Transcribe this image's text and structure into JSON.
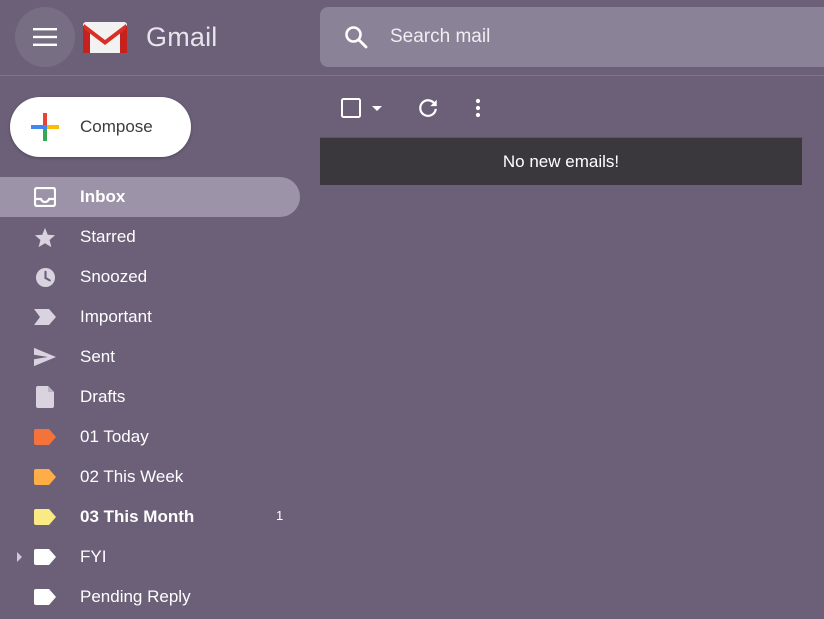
{
  "app": {
    "logo_text": "Gmail",
    "brand_colors": {
      "red": "#d93025",
      "logo_red": "#c5221f"
    }
  },
  "header": {
    "search_placeholder": "Search mail"
  },
  "compose": {
    "label": "Compose"
  },
  "nav": {
    "items": [
      {
        "label": "Inbox",
        "icon": "inbox-icon",
        "active": true,
        "bold": true
      },
      {
        "label": "Starred",
        "icon": "star-icon"
      },
      {
        "label": "Snoozed",
        "icon": "clock-icon"
      },
      {
        "label": "Important",
        "icon": "important-icon"
      },
      {
        "label": "Sent",
        "icon": "send-icon"
      },
      {
        "label": "Drafts",
        "icon": "draft-icon"
      },
      {
        "label": "01 Today",
        "icon": "label-icon",
        "color": "#f4733b"
      },
      {
        "label": "02 This Week",
        "icon": "label-icon",
        "color": "#ffad46"
      },
      {
        "label": "03 This Month",
        "icon": "label-icon",
        "color": "#fbe983",
        "bold": true,
        "count": "1"
      },
      {
        "label": "FYI",
        "icon": "label-icon",
        "color": "#ffffff",
        "expandable": true
      },
      {
        "label": "Pending Reply",
        "icon": "label-icon",
        "color": "#ffffff"
      }
    ]
  },
  "main": {
    "empty_message": "No new emails!"
  },
  "colors": {
    "background": "#6b6078",
    "active_item": "#9c93a8",
    "message_bar": "#3a383d"
  }
}
